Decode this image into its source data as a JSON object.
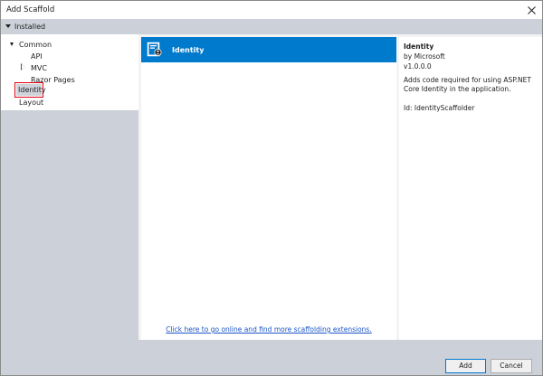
{
  "window": {
    "title": "Add Scaffold",
    "close_glyph": "✕"
  },
  "installed": {
    "label": "Installed"
  },
  "tree": {
    "common": "Common",
    "api": "API",
    "mvc": "MVC",
    "razor_pages": "Razor Pages",
    "identity": "Identity",
    "layout": "Layout"
  },
  "center": {
    "items": [
      {
        "name": "Identity",
        "icon": "scaffold-item-icon"
      }
    ],
    "online_link": "Click here to go online and find more scaffolding extensions."
  },
  "details": {
    "title": "Identity",
    "author": "by Microsoft",
    "version": "v1.0.0.0",
    "description": "Adds code required for using ASP.NET Core Identity in the application.",
    "id": "Id: IdentityScaffolder"
  },
  "footer": {
    "add_label": "Add",
    "cancel_label": "Cancel"
  },
  "colors": {
    "selection": "#007acc",
    "panel": "#ccd0d8",
    "highlight_box": "#e3000f",
    "link": "#1a55c9"
  }
}
